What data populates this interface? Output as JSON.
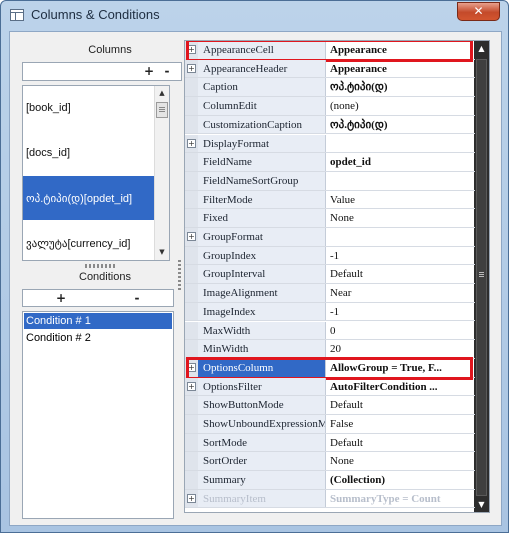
{
  "window": {
    "title": "Columns & Conditions",
    "close_label": "✕"
  },
  "columns_panel": {
    "label": "Columns",
    "add_label": "+",
    "remove_label": "-",
    "items": [
      "[book_id]",
      "[docs_id]",
      "ოპ.ტიპი(დ)[opdet_id]",
      "ვალუტა[currency_id]"
    ],
    "selected_index": 2
  },
  "conditions_panel": {
    "label": "Conditions",
    "add_label": "+",
    "remove_label": "-",
    "items": [
      "Condition # 1",
      "Condition # 2"
    ],
    "selected_index": 0
  },
  "properties": [
    {
      "name": "AppearanceCell",
      "value": "Appearance",
      "expandable": true,
      "bold": true,
      "highlight": true
    },
    {
      "name": "AppearanceHeader",
      "value": "Appearance",
      "expandable": true,
      "bold": true
    },
    {
      "name": "Caption",
      "value": "ოპ.ტიპი(დ)",
      "bold": true
    },
    {
      "name": "ColumnEdit",
      "value": "(none)"
    },
    {
      "name": "CustomizationCaption",
      "value": "ოპ.ტიპი(დ)",
      "bold": true
    },
    {
      "name": "DisplayFormat",
      "value": "",
      "expandable": true
    },
    {
      "name": "FieldName",
      "value": "opdet_id",
      "bold": true
    },
    {
      "name": "FieldNameSortGroup",
      "value": ""
    },
    {
      "name": "FilterMode",
      "value": "Value"
    },
    {
      "name": "Fixed",
      "value": "None"
    },
    {
      "name": "GroupFormat",
      "value": "",
      "expandable": true
    },
    {
      "name": "GroupIndex",
      "value": "-1"
    },
    {
      "name": "GroupInterval",
      "value": "Default"
    },
    {
      "name": "ImageAlignment",
      "value": "Near"
    },
    {
      "name": "ImageIndex",
      "value": "-1"
    },
    {
      "name": "MaxWidth",
      "value": "0"
    },
    {
      "name": "MinWidth",
      "value": "20"
    },
    {
      "name": "OptionsColumn",
      "value": "AllowGroup = True, F...",
      "expandable": true,
      "bold": true,
      "selected": true,
      "highlight": true
    },
    {
      "name": "OptionsFilter",
      "value": "AutoFilterCondition ...",
      "expandable": true,
      "bold": true
    },
    {
      "name": "ShowButtonMode",
      "value": "Default"
    },
    {
      "name": "ShowUnboundExpressionMenu",
      "value": "False"
    },
    {
      "name": "SortMode",
      "value": "Default"
    },
    {
      "name": "SortOrder",
      "value": "None"
    },
    {
      "name": "Summary",
      "value": "(Collection)",
      "bold": true
    },
    {
      "name": "SummaryItem",
      "value": "SummaryType = Count",
      "expandable": true,
      "bold": true,
      "faded": true
    }
  ],
  "colors": {
    "selection": "#3169c6",
    "highlight_border": "#e0161e"
  }
}
